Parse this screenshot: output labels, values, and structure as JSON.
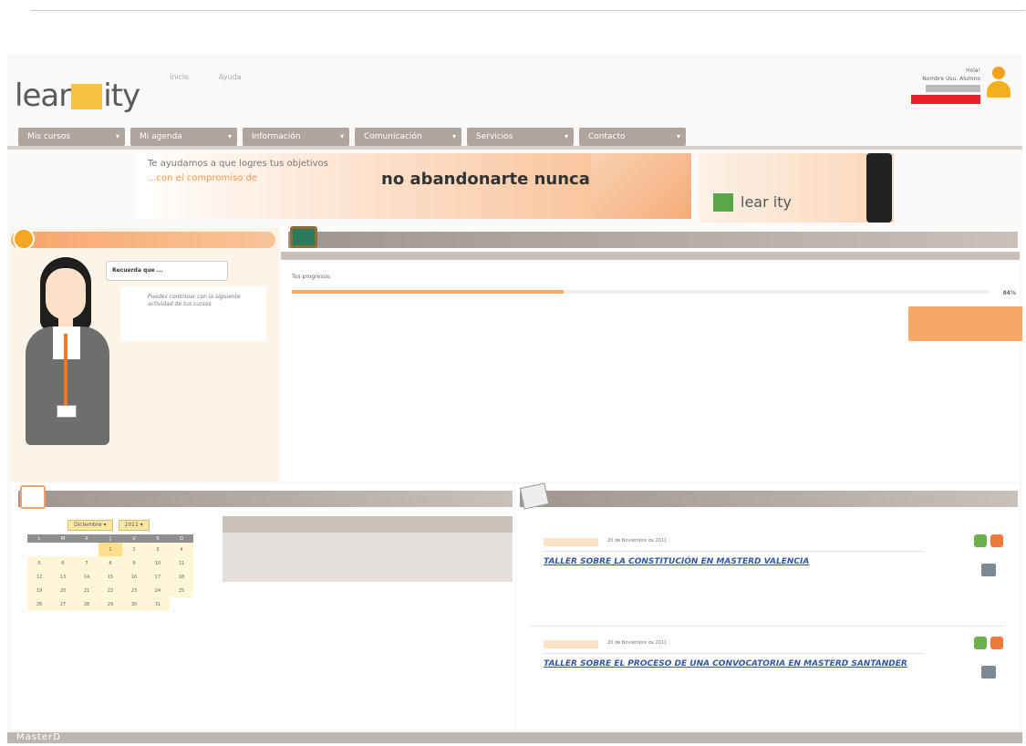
{
  "brand": {
    "logo_left": "lear",
    "logo_right": "ity"
  },
  "toplinks": [
    "Inicio",
    "Ayuda"
  ],
  "user": {
    "greeting": "Hola!",
    "name": "Nombre Usu. Alumno"
  },
  "nav": [
    "Mis cursos",
    "Mi agenda",
    "Información",
    "Comunicación",
    "Servicios",
    "Contacto"
  ],
  "banner": {
    "line1": "Te ayudamos a que logres tus objetivos",
    "line2": "...con el compromiso de",
    "headline": "no abandonarte nunca."
  },
  "promo": {
    "logo": "lear ity"
  },
  "assistant": {
    "title": "Recuerda que ...",
    "message": "Puedes continuar con la siguiente actividad de tus cursos"
  },
  "progress": {
    "label": "Tus progresos:",
    "value": 0.39,
    "percent_text": "84%"
  },
  "calendar": {
    "month": "Diciembre",
    "year": "2011",
    "weekdays": [
      "L",
      "M",
      "X",
      "J",
      "V",
      "S",
      "D"
    ]
  },
  "news": [
    {
      "date": "20 de Noviembre de 2011",
      "title": "TALLER SOBRE LA CONSTITUCIÓN EN MASTERD VALENCIA"
    },
    {
      "date": "20 de Noviembre de 2011",
      "title": "TALLER SOBRE EL PROCESO DE UNA CONVOCATORIA EN MASTERD SANTANDER"
    }
  ],
  "footer": {
    "brand": "MasterD"
  }
}
